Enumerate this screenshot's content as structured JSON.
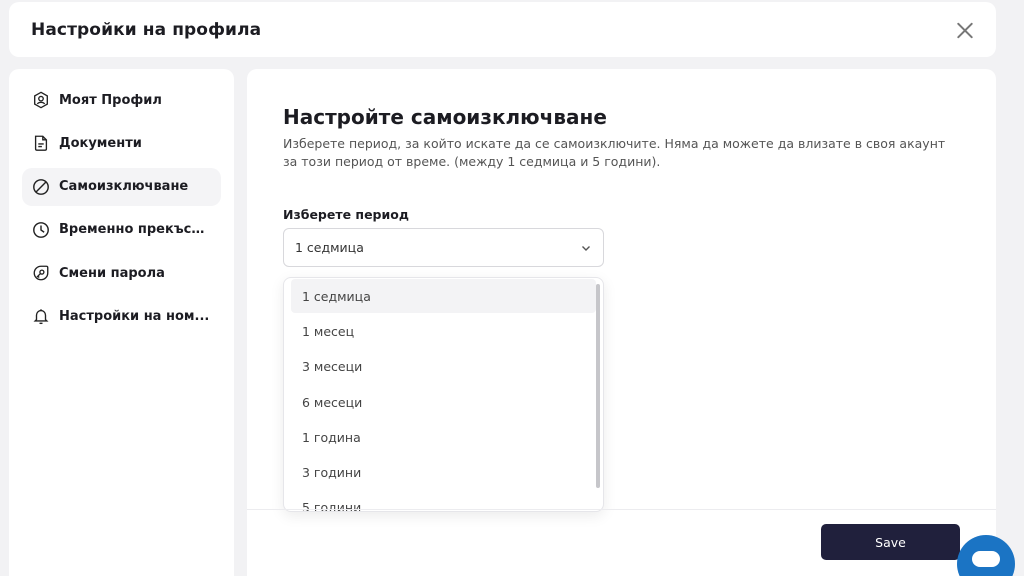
{
  "header": {
    "title": "Настройки на профила"
  },
  "sidebar": {
    "items": [
      {
        "label": "Моят Профил",
        "icon": "user-icon"
      },
      {
        "label": "Документи",
        "icon": "document-icon"
      },
      {
        "label": "Самоизключване",
        "icon": "block-icon",
        "active": true
      },
      {
        "label": "Временно прекъсв...",
        "icon": "clock-icon"
      },
      {
        "label": "Смени парола",
        "icon": "key-icon"
      },
      {
        "label": "Настройки на ном...",
        "icon": "bell-icon"
      }
    ]
  },
  "main": {
    "title": "Настройте самоизключване",
    "description": "Изберете период, за който искате да се самоизключите. Няма да можете да влизате в своя акаунт за този период от време. (между 1 седмица и 5 години).",
    "period_label": "Изберете период",
    "selected_value": "1 седмица",
    "options": [
      "1 седмица",
      "1 месец",
      "3 месеци",
      "6 месеци",
      "1 година",
      "3 години",
      "5 години"
    ],
    "save_label": "Save"
  },
  "colors": {
    "primary_button": "#20203c",
    "chat_button": "#1b74c4"
  }
}
